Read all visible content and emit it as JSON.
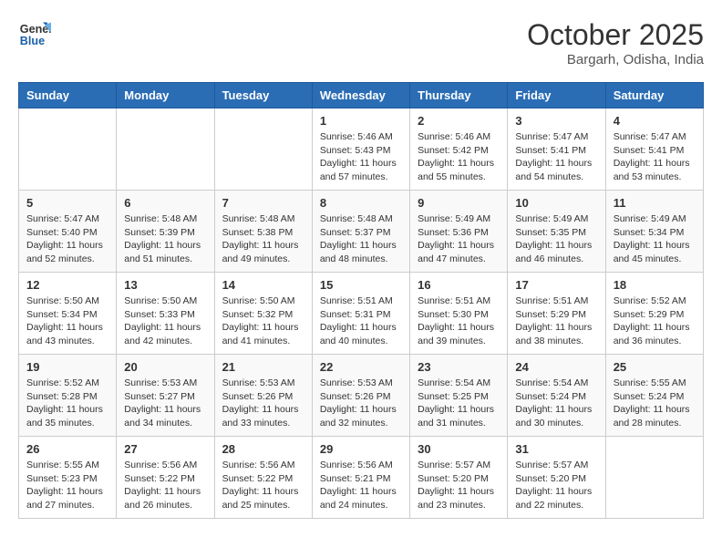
{
  "logo": {
    "line1": "General",
    "line2": "Blue"
  },
  "title": "October 2025",
  "subtitle": "Bargarh, Odisha, India",
  "weekdays": [
    "Sunday",
    "Monday",
    "Tuesday",
    "Wednesday",
    "Thursday",
    "Friday",
    "Saturday"
  ],
  "weeks": [
    [
      {
        "num": "",
        "info": ""
      },
      {
        "num": "",
        "info": ""
      },
      {
        "num": "",
        "info": ""
      },
      {
        "num": "1",
        "info": "Sunrise: 5:46 AM\nSunset: 5:43 PM\nDaylight: 11 hours\nand 57 minutes."
      },
      {
        "num": "2",
        "info": "Sunrise: 5:46 AM\nSunset: 5:42 PM\nDaylight: 11 hours\nand 55 minutes."
      },
      {
        "num": "3",
        "info": "Sunrise: 5:47 AM\nSunset: 5:41 PM\nDaylight: 11 hours\nand 54 minutes."
      },
      {
        "num": "4",
        "info": "Sunrise: 5:47 AM\nSunset: 5:41 PM\nDaylight: 11 hours\nand 53 minutes."
      }
    ],
    [
      {
        "num": "5",
        "info": "Sunrise: 5:47 AM\nSunset: 5:40 PM\nDaylight: 11 hours\nand 52 minutes."
      },
      {
        "num": "6",
        "info": "Sunrise: 5:48 AM\nSunset: 5:39 PM\nDaylight: 11 hours\nand 51 minutes."
      },
      {
        "num": "7",
        "info": "Sunrise: 5:48 AM\nSunset: 5:38 PM\nDaylight: 11 hours\nand 49 minutes."
      },
      {
        "num": "8",
        "info": "Sunrise: 5:48 AM\nSunset: 5:37 PM\nDaylight: 11 hours\nand 48 minutes."
      },
      {
        "num": "9",
        "info": "Sunrise: 5:49 AM\nSunset: 5:36 PM\nDaylight: 11 hours\nand 47 minutes."
      },
      {
        "num": "10",
        "info": "Sunrise: 5:49 AM\nSunset: 5:35 PM\nDaylight: 11 hours\nand 46 minutes."
      },
      {
        "num": "11",
        "info": "Sunrise: 5:49 AM\nSunset: 5:34 PM\nDaylight: 11 hours\nand 45 minutes."
      }
    ],
    [
      {
        "num": "12",
        "info": "Sunrise: 5:50 AM\nSunset: 5:34 PM\nDaylight: 11 hours\nand 43 minutes."
      },
      {
        "num": "13",
        "info": "Sunrise: 5:50 AM\nSunset: 5:33 PM\nDaylight: 11 hours\nand 42 minutes."
      },
      {
        "num": "14",
        "info": "Sunrise: 5:50 AM\nSunset: 5:32 PM\nDaylight: 11 hours\nand 41 minutes."
      },
      {
        "num": "15",
        "info": "Sunrise: 5:51 AM\nSunset: 5:31 PM\nDaylight: 11 hours\nand 40 minutes."
      },
      {
        "num": "16",
        "info": "Sunrise: 5:51 AM\nSunset: 5:30 PM\nDaylight: 11 hours\nand 39 minutes."
      },
      {
        "num": "17",
        "info": "Sunrise: 5:51 AM\nSunset: 5:29 PM\nDaylight: 11 hours\nand 38 minutes."
      },
      {
        "num": "18",
        "info": "Sunrise: 5:52 AM\nSunset: 5:29 PM\nDaylight: 11 hours\nand 36 minutes."
      }
    ],
    [
      {
        "num": "19",
        "info": "Sunrise: 5:52 AM\nSunset: 5:28 PM\nDaylight: 11 hours\nand 35 minutes."
      },
      {
        "num": "20",
        "info": "Sunrise: 5:53 AM\nSunset: 5:27 PM\nDaylight: 11 hours\nand 34 minutes."
      },
      {
        "num": "21",
        "info": "Sunrise: 5:53 AM\nSunset: 5:26 PM\nDaylight: 11 hours\nand 33 minutes."
      },
      {
        "num": "22",
        "info": "Sunrise: 5:53 AM\nSunset: 5:26 PM\nDaylight: 11 hours\nand 32 minutes."
      },
      {
        "num": "23",
        "info": "Sunrise: 5:54 AM\nSunset: 5:25 PM\nDaylight: 11 hours\nand 31 minutes."
      },
      {
        "num": "24",
        "info": "Sunrise: 5:54 AM\nSunset: 5:24 PM\nDaylight: 11 hours\nand 30 minutes."
      },
      {
        "num": "25",
        "info": "Sunrise: 5:55 AM\nSunset: 5:24 PM\nDaylight: 11 hours\nand 28 minutes."
      }
    ],
    [
      {
        "num": "26",
        "info": "Sunrise: 5:55 AM\nSunset: 5:23 PM\nDaylight: 11 hours\nand 27 minutes."
      },
      {
        "num": "27",
        "info": "Sunrise: 5:56 AM\nSunset: 5:22 PM\nDaylight: 11 hours\nand 26 minutes."
      },
      {
        "num": "28",
        "info": "Sunrise: 5:56 AM\nSunset: 5:22 PM\nDaylight: 11 hours\nand 25 minutes."
      },
      {
        "num": "29",
        "info": "Sunrise: 5:56 AM\nSunset: 5:21 PM\nDaylight: 11 hours\nand 24 minutes."
      },
      {
        "num": "30",
        "info": "Sunrise: 5:57 AM\nSunset: 5:20 PM\nDaylight: 11 hours\nand 23 minutes."
      },
      {
        "num": "31",
        "info": "Sunrise: 5:57 AM\nSunset: 5:20 PM\nDaylight: 11 hours\nand 22 minutes."
      },
      {
        "num": "",
        "info": ""
      }
    ]
  ]
}
